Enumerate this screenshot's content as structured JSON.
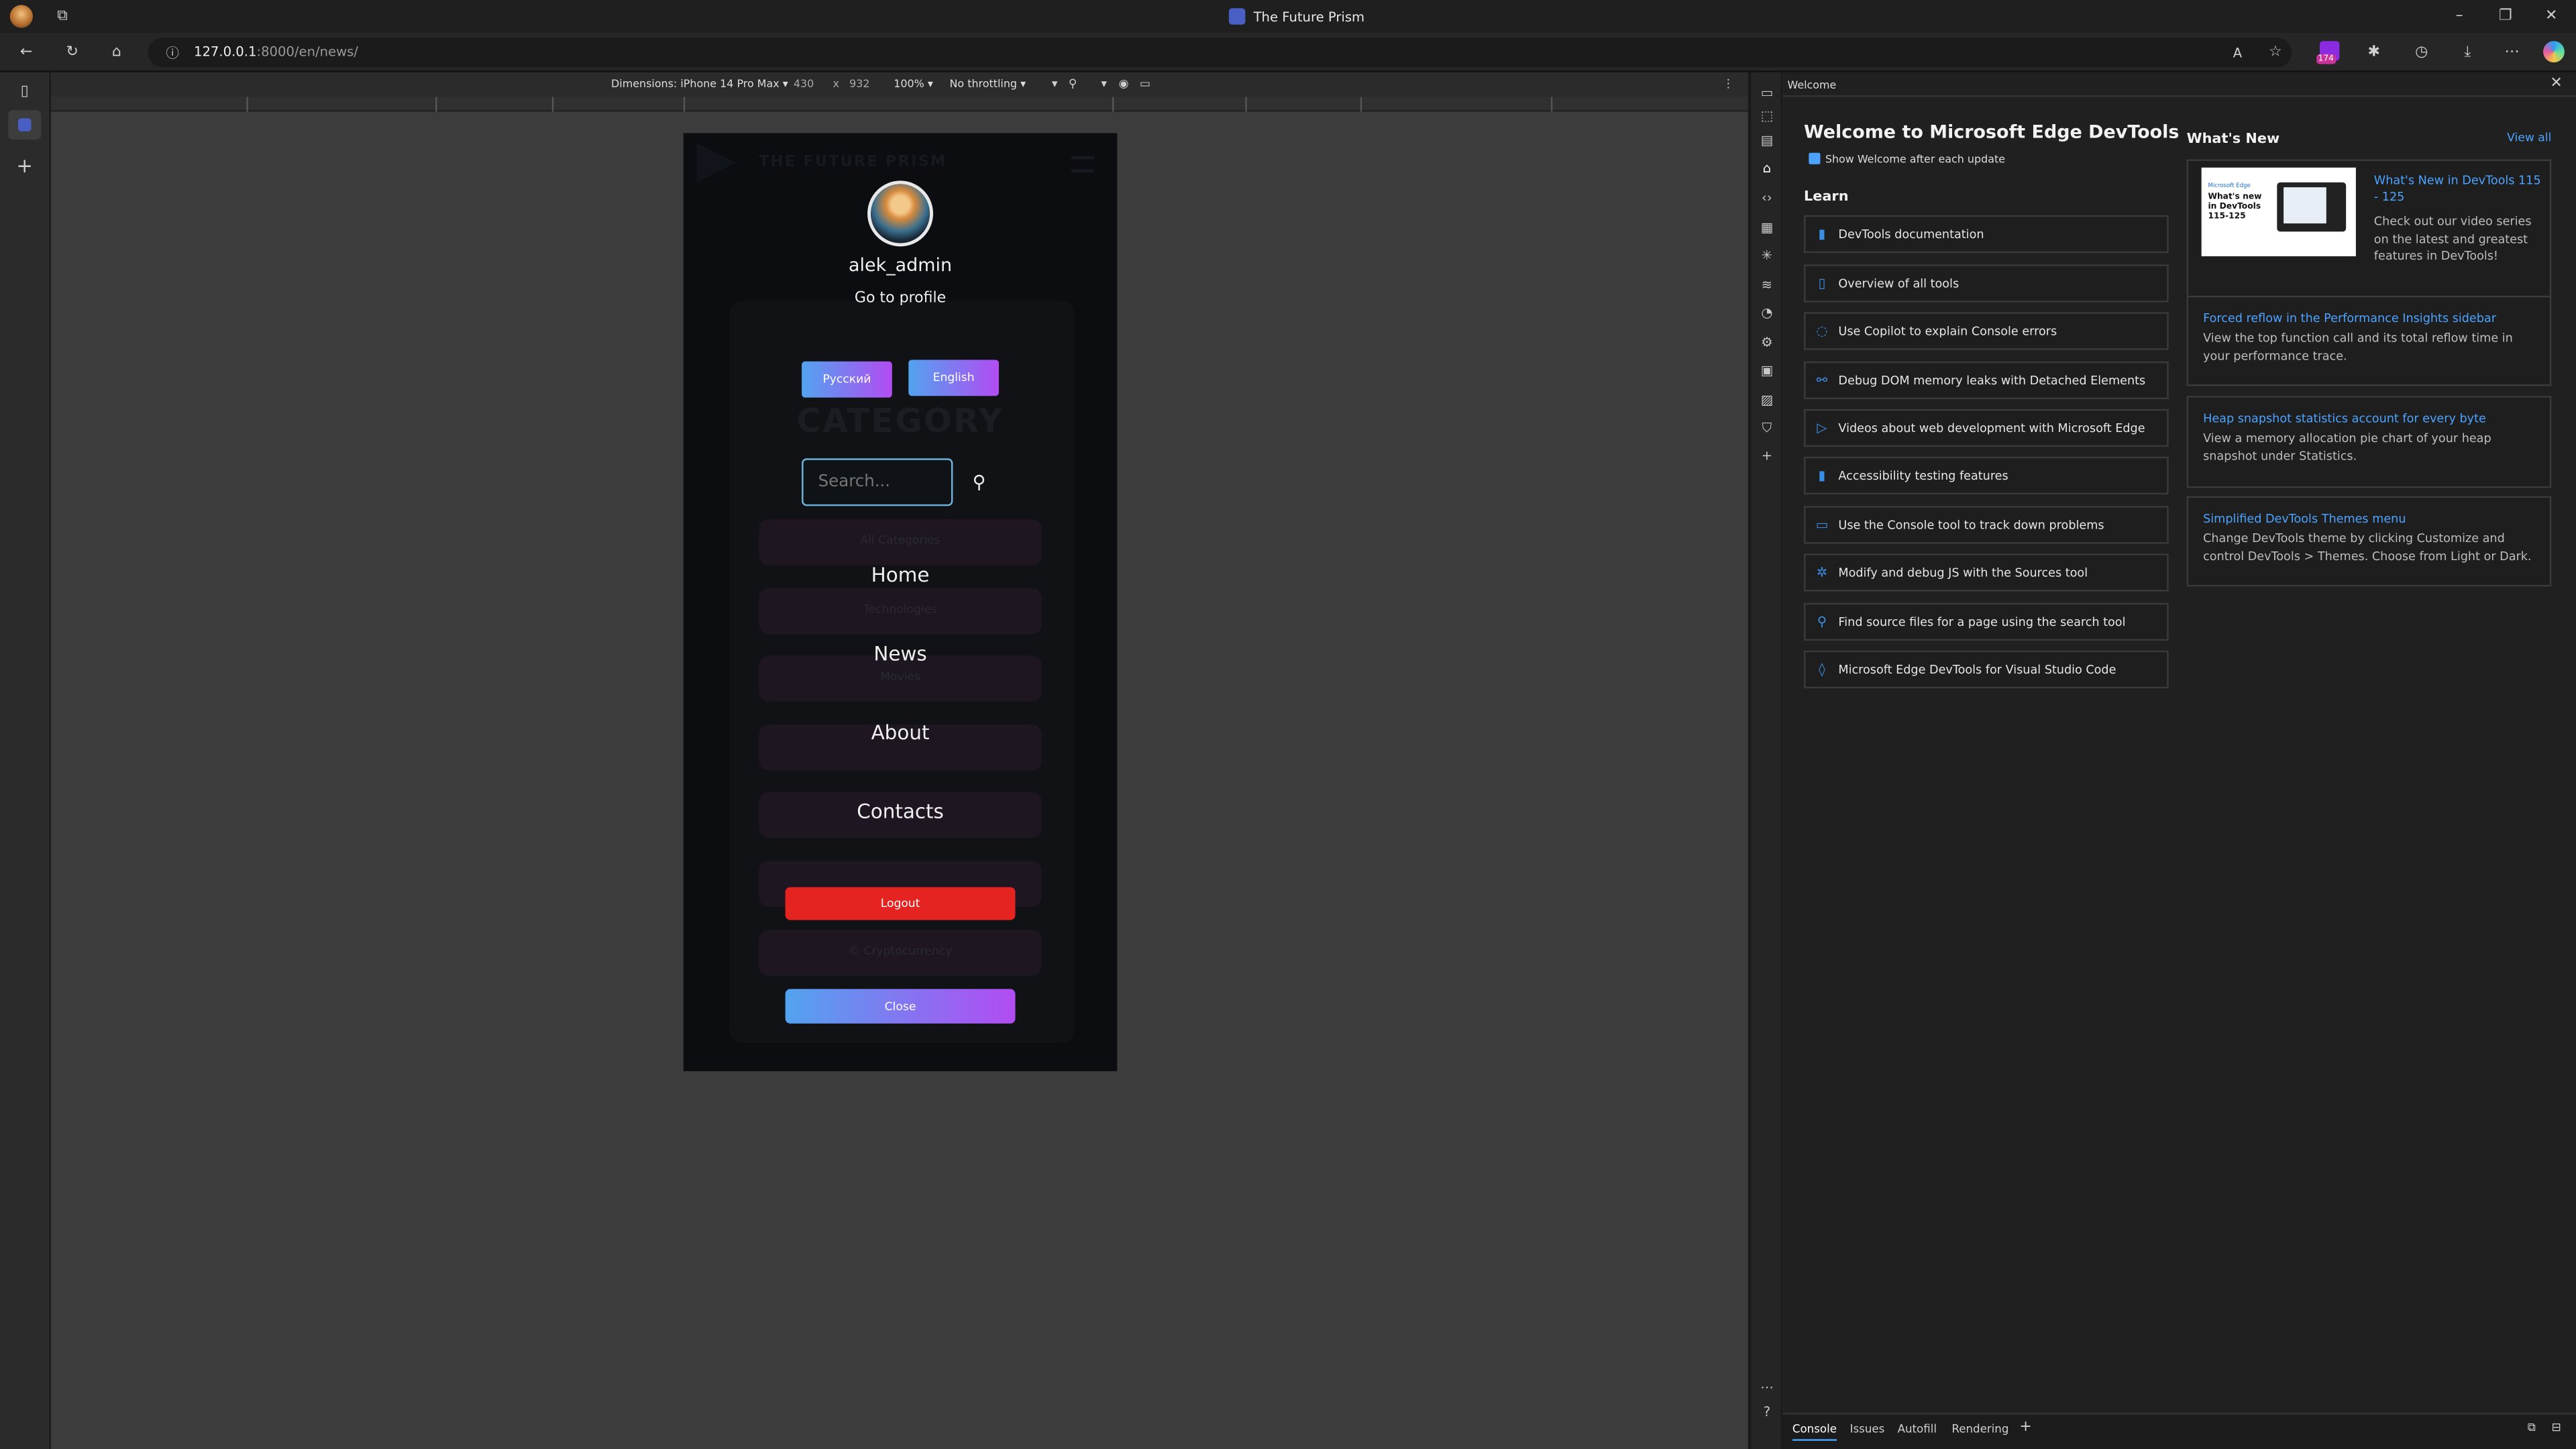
{
  "browser": {
    "window_title": "The Future Prism",
    "url_host": "127.0.0.1",
    "url_rest": ":8000/en/news/",
    "badge_count": "174"
  },
  "device_toolbar": {
    "dimensions_label": "Dimensions: iPhone 14 Pro Max",
    "width": "430",
    "height": "932",
    "times": "x",
    "zoom": "100%",
    "throttling": "No throttling"
  },
  "phone": {
    "site_name": "THE FUTURE PRISM",
    "username": "alek_admin",
    "profile_link": "Go to profile",
    "lang_ru": "Русский",
    "lang_en": "English",
    "bg_heading": "CATEGORY",
    "search_placeholder": "Search...",
    "bg_items": [
      "All Categories",
      "Technologies",
      "Movies",
      "",
      "",
      "© Cryptocurrency"
    ],
    "nav": [
      "Home",
      "News",
      "About",
      "Contacts"
    ],
    "logout": "Logout",
    "close": "Close"
  },
  "devtools": {
    "tab_title": "Welcome",
    "heading": "Welcome to Microsoft Edge DevTools",
    "show_welcome": "Show Welcome after each update",
    "learn_title": "Learn",
    "learn_items": [
      "DevTools documentation",
      "Overview of all tools",
      "Use Copilot to explain Console errors",
      "Debug DOM memory leaks with Detached Elements",
      "Videos about web development with Microsoft Edge",
      "Accessibility testing features",
      "Use the Console tool to track down problems",
      "Modify and debug JS with the Sources tool",
      "Find source files for a page using the search tool",
      "Microsoft Edge DevTools for Visual Studio Code"
    ],
    "whats_new_title": "What's New",
    "view_all": "View all",
    "thumb_text": "What's new in DevTools 115-125",
    "thumb_small": "Microsoft Edge",
    "news": [
      {
        "title": "What's New in DevTools 115 - 125",
        "desc": "Check out our video series on the latest and greatest features in DevTools!"
      },
      {
        "title": "Forced reflow in the Performance Insights sidebar",
        "desc": "View the top function call and its total reflow time in your performance trace."
      },
      {
        "title": "Heap snapshot statistics account for every byte",
        "desc": "View a memory allocation pie chart of your heap snapshot under Statistics."
      },
      {
        "title": "Simplified DevTools Themes menu",
        "desc": "Change DevTools theme by clicking Customize and control DevTools > Themes. Choose from Light or Dark."
      }
    ],
    "bottom_tabs": [
      "Console",
      "Issues",
      "Autofill",
      "Rendering"
    ]
  },
  "colors": {
    "accent_blue": "#4ca3ff",
    "logout_red": "#e52421",
    "gradient_start": "#52a3ef",
    "gradient_end": "#b24cf2"
  }
}
